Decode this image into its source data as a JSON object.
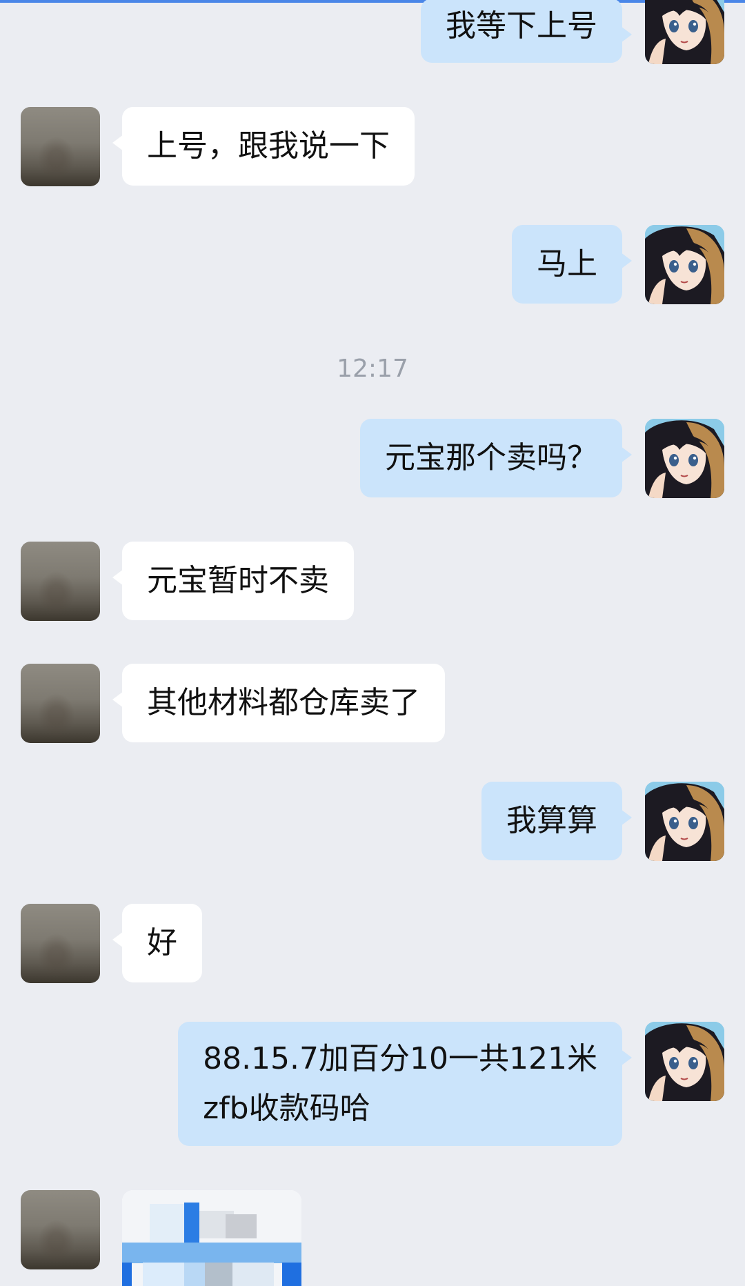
{
  "messages": {
    "m1": {
      "text": "我等下上号"
    },
    "m2": {
      "text": "上号，跟我说一下"
    },
    "m3": {
      "text": "马上"
    },
    "time_divider": "12:17",
    "m4": {
      "text": "元宝那个卖吗？"
    },
    "m5": {
      "text": "元宝暂时不卖"
    },
    "m6": {
      "text": "其他材料都仓库卖了"
    },
    "m7": {
      "text": "我算算"
    },
    "m8": {
      "text": "好"
    },
    "m9": {
      "lines": [
        "88.15.7加百分10一共121米",
        "zfb收款码哈"
      ]
    },
    "m10": {
      "type": "image",
      "content": "blurred QR code image"
    }
  },
  "colors": {
    "background": "#ebedf2",
    "sent_bubble": "#cbe4fb",
    "received_bubble": "#ffffff",
    "accent": "#4a86e8"
  }
}
